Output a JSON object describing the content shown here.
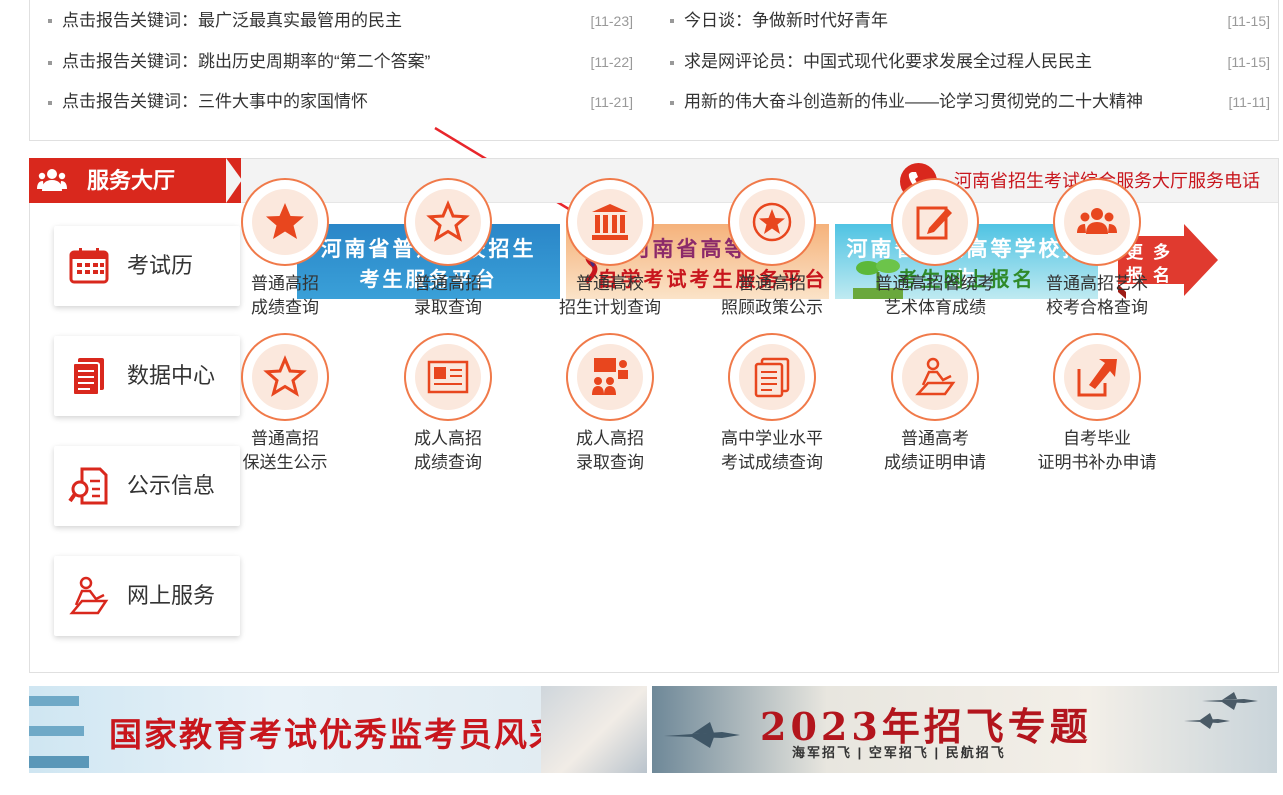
{
  "news": {
    "left": [
      {
        "title": "点击报告关键词：最广泛最真实最管用的民主",
        "date": "[11-23]"
      },
      {
        "title": "点击报告关键词：跳出历史周期率的“第二个答案”",
        "date": "[11-22]"
      },
      {
        "title": "点击报告关键词：三件大事中的家国情怀",
        "date": "[11-21]"
      }
    ],
    "right": [
      {
        "title": "今日谈：争做新时代好青年",
        "date": "[11-15]"
      },
      {
        "title": "求是网评论员：中国式现代化要求发展全过程人民民主",
        "date": "[11-15]"
      },
      {
        "title": "用新的伟大奋斗创造新的伟业——论学习贯彻党的二十大精神",
        "date": "[11-11]"
      }
    ]
  },
  "hall": {
    "title": "服务大厅",
    "phone_label": "河南省招生考试综合服务大厅服务电话",
    "side_buttons": [
      {
        "label": "考试历",
        "icon": "calendar-icon"
      },
      {
        "label": "数据中心",
        "icon": "document-stack-icon"
      },
      {
        "label": "公示信息",
        "icon": "search-document-icon"
      },
      {
        "label": "网上服务",
        "icon": "person-desk-icon"
      }
    ],
    "banners": [
      {
        "line1": "河南省普通高校招生",
        "line2": "考生服务平台"
      },
      {
        "line1": "河南省高等教育",
        "line2": "自学考试考生服务平台"
      },
      {
        "line1": "河南省成人高等学校招生",
        "line2": "考生网上报名"
      },
      {
        "line1": "更多",
        "line2": "报名"
      }
    ],
    "services": [
      {
        "t1": "普通高招",
        "t2": "成绩查询",
        "icon": "star-icon"
      },
      {
        "t1": "普通高招",
        "t2": "录取查询",
        "icon": "star-outline-icon"
      },
      {
        "t1": "普通高校",
        "t2": "招生计划查询",
        "icon": "building-icon"
      },
      {
        "t1": "普通高招",
        "t2": "照顾政策公示",
        "icon": "star-badge-icon"
      },
      {
        "t1": "普通高招省统考",
        "t2": "艺术体育成绩",
        "icon": "edit-icon"
      },
      {
        "t1": "普通高招艺术",
        "t2": "校考合格查询",
        "icon": "group-icon"
      },
      {
        "t1": "普通高招",
        "t2": "保送生公示",
        "icon": "star-outline-icon"
      },
      {
        "t1": "成人高招",
        "t2": "成绩查询",
        "icon": "certificate-icon"
      },
      {
        "t1": "成人高招",
        "t2": "录取查询",
        "icon": "presentation-icon"
      },
      {
        "t1": "高中学业水平",
        "t2": "考试成绩查询",
        "icon": "document-stack-icon"
      },
      {
        "t1": "普通高考",
        "t2": "成绩证明申请",
        "icon": "person-desk-icon"
      },
      {
        "t1": "自考毕业",
        "t2": "证明书补办申请",
        "icon": "export-icon"
      }
    ]
  },
  "bottom_banners": [
    {
      "text": "国家教育考试优秀监考员风采"
    },
    {
      "title": "2023年招飞专题",
      "sub": "海军招飞 | 空军招飞 | 民航招飞"
    }
  ]
}
